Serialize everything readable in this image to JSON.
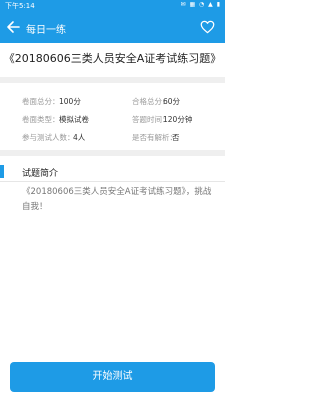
{
  "status_bar": {
    "time": "下午5:14",
    "icons": "✉ ▦ ◔ ▲ ▮"
  },
  "app_bar": {
    "title": "每日一练"
  },
  "exam": {
    "title": "《20180606三类人员安全A证考试练习题》"
  },
  "info": {
    "total_score": {
      "label": "卷面总分：",
      "value": "100分"
    },
    "pass_score": {
      "label": "合格总分：",
      "value": "60分"
    },
    "paper_type": {
      "label": "卷面类型：",
      "value": "模拟试卷"
    },
    "answer_time": {
      "label": "答题时间：",
      "value": "120分钟"
    },
    "participants": {
      "label": "参与测试人数：",
      "value": "4人"
    },
    "has_analysis": {
      "label": "是否有解析：",
      "value": "否"
    }
  },
  "intro": {
    "heading": "试题简介",
    "body": "《20180606三类人员安全A证考试练习题》，挑战自我！"
  },
  "start_button": {
    "label": "开始测试"
  },
  "colors": {
    "accent": "#1e9be6",
    "separator": "#efefef"
  }
}
